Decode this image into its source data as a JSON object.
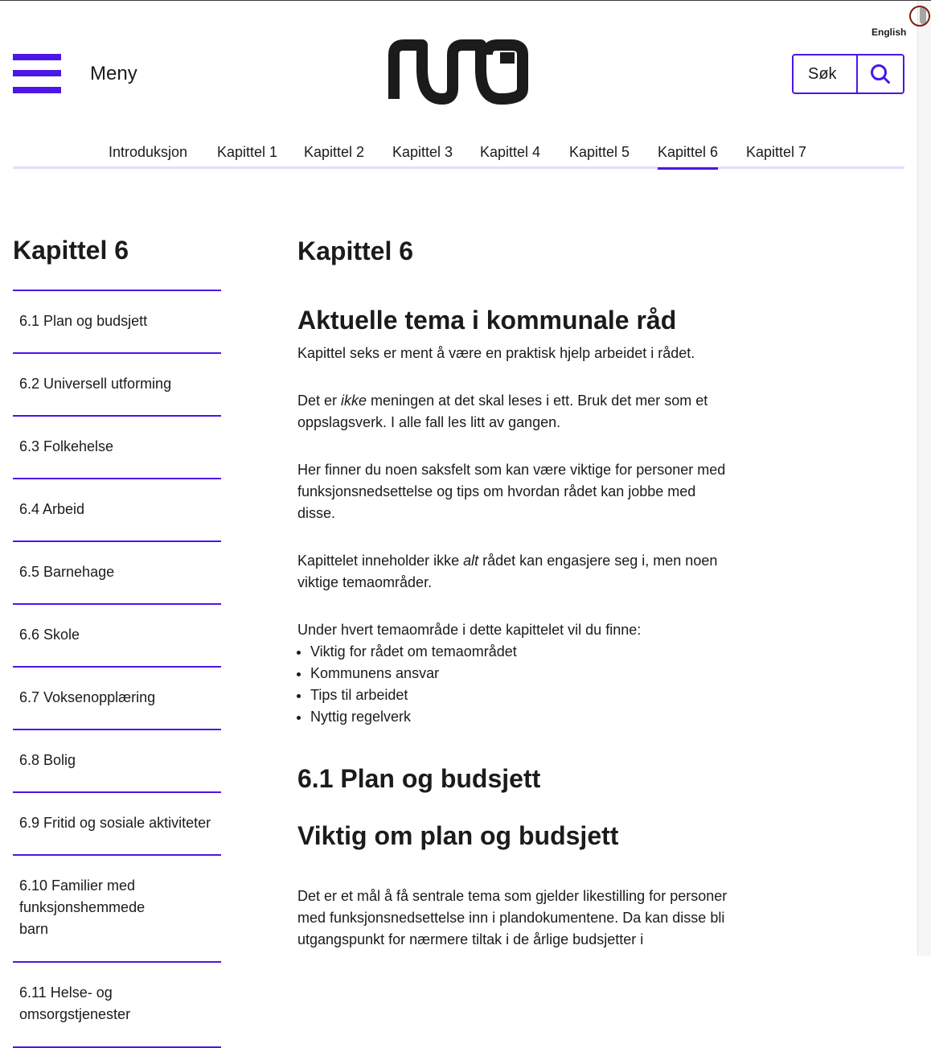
{
  "header": {
    "language_link": "English",
    "menu_label": "Meny",
    "search_label": "Søk"
  },
  "chapter_nav": {
    "items": [
      {
        "label": "Introduksjon"
      },
      {
        "label": "Kapittel 1"
      },
      {
        "label": "Kapittel 2"
      },
      {
        "label": "Kapittel 3"
      },
      {
        "label": "Kapittel 4"
      },
      {
        "label": "Kapittel 5"
      },
      {
        "label": "Kapittel 6",
        "active": true
      },
      {
        "label": "Kapittel 7"
      }
    ]
  },
  "sidebar": {
    "title": "Kapittel 6",
    "items": [
      {
        "label": "6.1 Plan og budsjett"
      },
      {
        "label": "6.2 Universell utforming"
      },
      {
        "label": "6.3 Folkehelse"
      },
      {
        "label": "6.4 Arbeid"
      },
      {
        "label": "6.5 Barnehage"
      },
      {
        "label": "6.6 Skole"
      },
      {
        "label": "6.7 Voksenopplæring"
      },
      {
        "label": "6.8 Bolig"
      },
      {
        "label": "6.9 Fritid og sosiale aktiviteter"
      },
      {
        "label": "6.10 Familier med funksjonshemmede barn"
      },
      {
        "label": "6.11 Helse- og omsorgstjenester"
      }
    ]
  },
  "main": {
    "title": "Kapittel 6",
    "heading": "Aktuelle tema i kommunale råd",
    "p1": "Kapittel seks er ment å være en praktisk hjelp arbeidet i rådet.",
    "p2_before": "Det er ",
    "p2_em": "ikke",
    "p2_after": " meningen at det skal leses i ett. Bruk det mer som et oppslagsverk. I alle fall les litt av gangen.",
    "p3": "Her finner du noen saksfelt som kan være viktige for personer med funksjonsnedsettelse og tips om hvordan rådet kan jobbe med disse.",
    "p4_before": "Kapittelet inneholder ikke ",
    "p4_em": "alt",
    "p4_after": " rådet kan engasjere seg i, men noen viktige temaområder.",
    "list_intro": "Under hvert temaområde i dette kapittelet vil du finne:",
    "list": [
      "Viktig for rådet om temaområdet",
      "Kommunens ansvar",
      "Tips til arbeidet",
      "Nyttig regelverk"
    ],
    "section_heading": "6.1 Plan og budsjett",
    "subsection_heading": "Viktig om plan og budsjett",
    "p5": "Det er et mål å få sentrale tema som gjelder likestilling for personer med funksjonsnedsettelse inn i plandokumentene. Da kan disse bli utgangspunkt for nærmere tiltak i de årlige budsjetter i"
  },
  "colors": {
    "accent": "#4b16e6",
    "nav_underline": "#e3ddf9",
    "text": "#1b1b1b"
  }
}
